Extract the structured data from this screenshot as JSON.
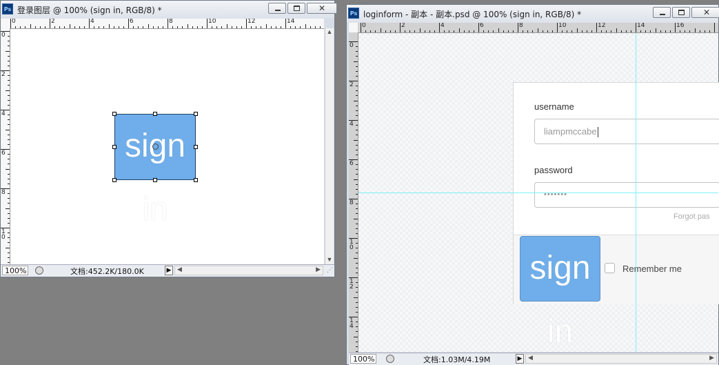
{
  "left_window": {
    "title": "登录图层 @ 100% (sign in, RGB/8) *",
    "app_icon": "Ps",
    "ruler_h_labels": [
      "0",
      "2",
      "4",
      "6",
      "8",
      "10",
      "12",
      "14"
    ],
    "ruler_v_labels": [
      "0",
      "2",
      "4",
      "6",
      "8",
      "1\n0"
    ],
    "button_text": "sign in",
    "status": {
      "zoom": "100%",
      "doc_info": "文档:452.2K/180.0K"
    }
  },
  "right_window": {
    "title": "loginform - 副本 - 副本.psd @ 100% (sign in, RGB/8) *",
    "app_icon": "Ps",
    "ruler_h_labels": [
      "0",
      "2",
      "4",
      "6",
      "8",
      "10",
      "12",
      "14",
      "16"
    ],
    "ruler_v_labels": [
      "0",
      "2",
      "4",
      "6",
      "8",
      "1\n0",
      "1\n2",
      "1\n4"
    ],
    "form": {
      "username_label": "username",
      "username_value": "liampmccabe",
      "password_label": "password",
      "password_value": "•••••••",
      "forgot_text": "Forgot pas",
      "signin_text": "sign in",
      "remember_label": "Remember me"
    },
    "status": {
      "zoom": "100%",
      "doc_info": "文档:1.03M/4.19M"
    }
  },
  "colors": {
    "signin_blue": "#6faeea",
    "guide_cyan": "#7ff0f5",
    "workspace_gray": "#808080"
  },
  "icons": [
    "photoshop-icon",
    "minimize-icon",
    "maximize-icon",
    "close-icon",
    "history-icon",
    "play-icon",
    "scroll-arrow-icon",
    "resize-grip-icon"
  ]
}
